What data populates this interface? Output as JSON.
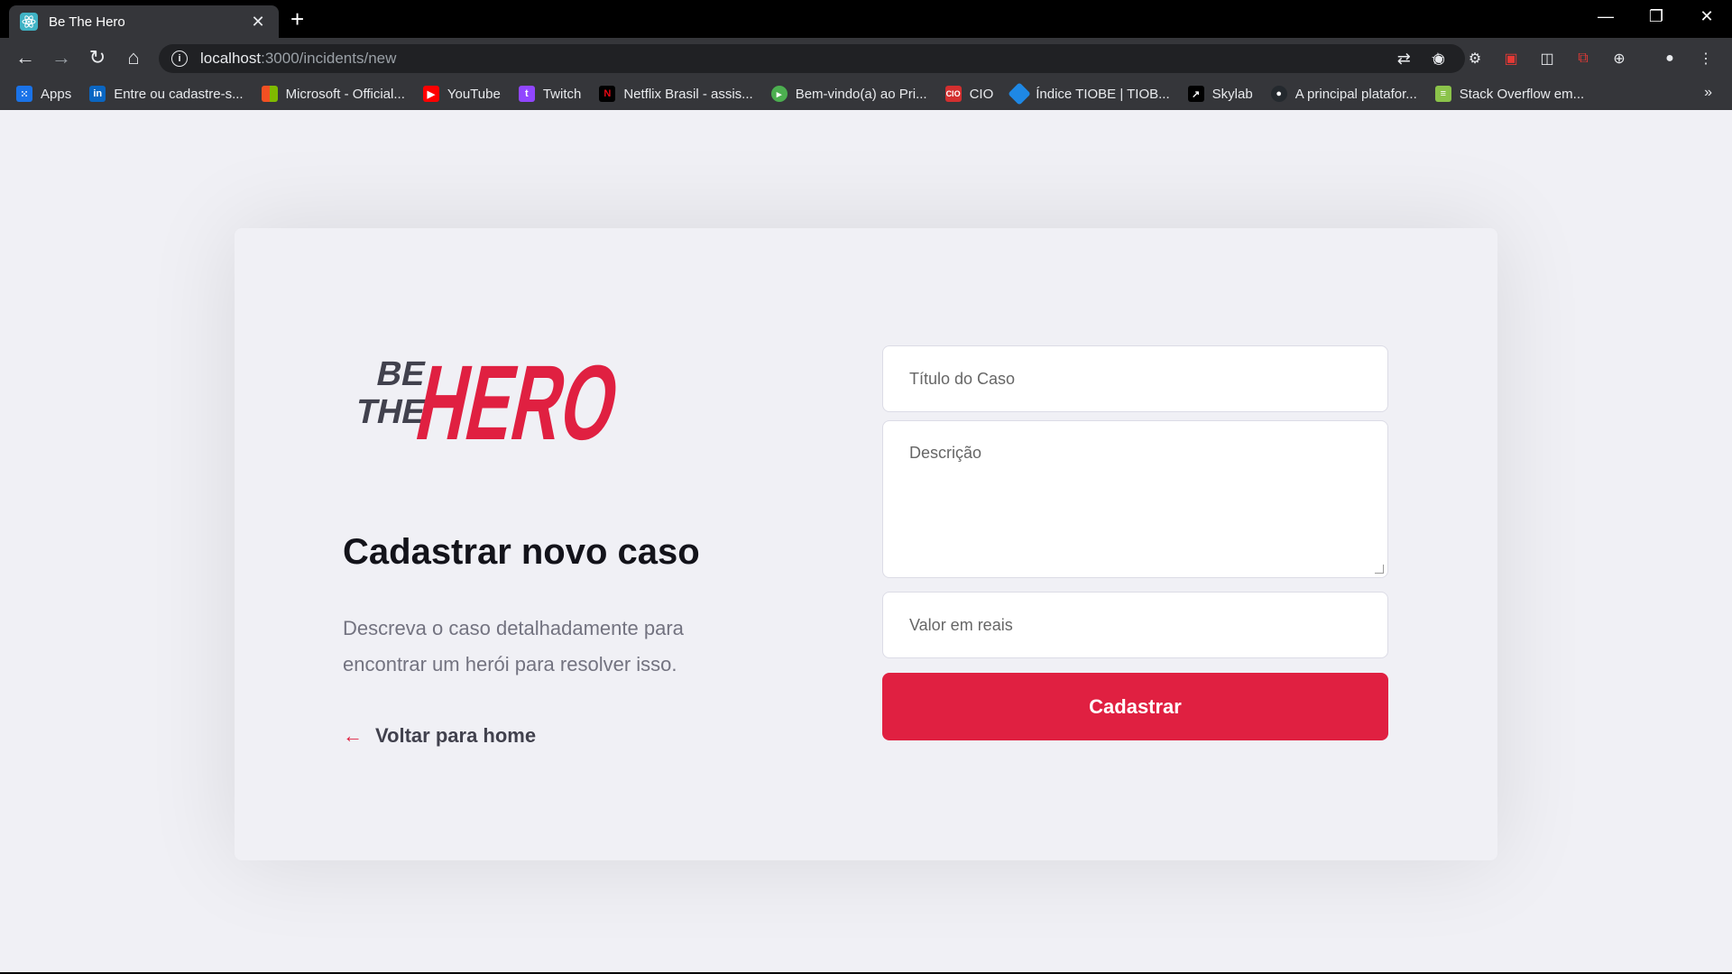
{
  "browser": {
    "tab_title": "Be The Hero",
    "url_host": "localhost",
    "url_path": ":3000/incidents/new",
    "bookmarks": [
      {
        "label": "Apps",
        "icon": "apps-grid-icon",
        "color": "#ea4335"
      },
      {
        "label": "Entre ou cadastre-s...",
        "icon": "linkedin-icon",
        "color": "#0a66c2"
      },
      {
        "label": "Microsoft - Official...",
        "icon": "microsoft-icon",
        "color": "#f25022"
      },
      {
        "label": "YouTube",
        "icon": "youtube-icon",
        "color": "#ff0000"
      },
      {
        "label": "Twitch",
        "icon": "twitch-icon",
        "color": "#9146ff"
      },
      {
        "label": "Netflix Brasil - assis...",
        "icon": "netflix-icon",
        "color": "#e50914"
      },
      {
        "label": "Bem-vindo(a) ao Pri...",
        "icon": "play-icon",
        "color": "#4caf50"
      },
      {
        "label": "CIO",
        "icon": "cio-icon",
        "color": "#d32f2f"
      },
      {
        "label": "Índice TIOBE | TIOB...",
        "icon": "tiobe-icon",
        "color": "#1e88e5"
      },
      {
        "label": "Skylab",
        "icon": "skylab-icon",
        "color": "#000000"
      },
      {
        "label": "A principal platafor...",
        "icon": "github-icon",
        "color": "#24292e"
      },
      {
        "label": "Stack Overflow em...",
        "icon": "stackoverflow-icon",
        "color": "#8bc34a"
      }
    ]
  },
  "page": {
    "logo_be": "BE",
    "logo_the": "THE",
    "logo_hero": "HERO",
    "heading": "Cadastrar novo caso",
    "description": "Descreva o caso detalhadamente para encontrar um herói para resolver isso.",
    "back_link": "Voltar para home",
    "form": {
      "title_placeholder": "Título do Caso",
      "description_placeholder": "Descrição",
      "value_placeholder": "Valor em reais",
      "submit_label": "Cadastrar"
    },
    "colors": {
      "accent": "#e02041",
      "background": "#f0f0f5",
      "heading": "#13131a",
      "text": "#737380"
    }
  }
}
